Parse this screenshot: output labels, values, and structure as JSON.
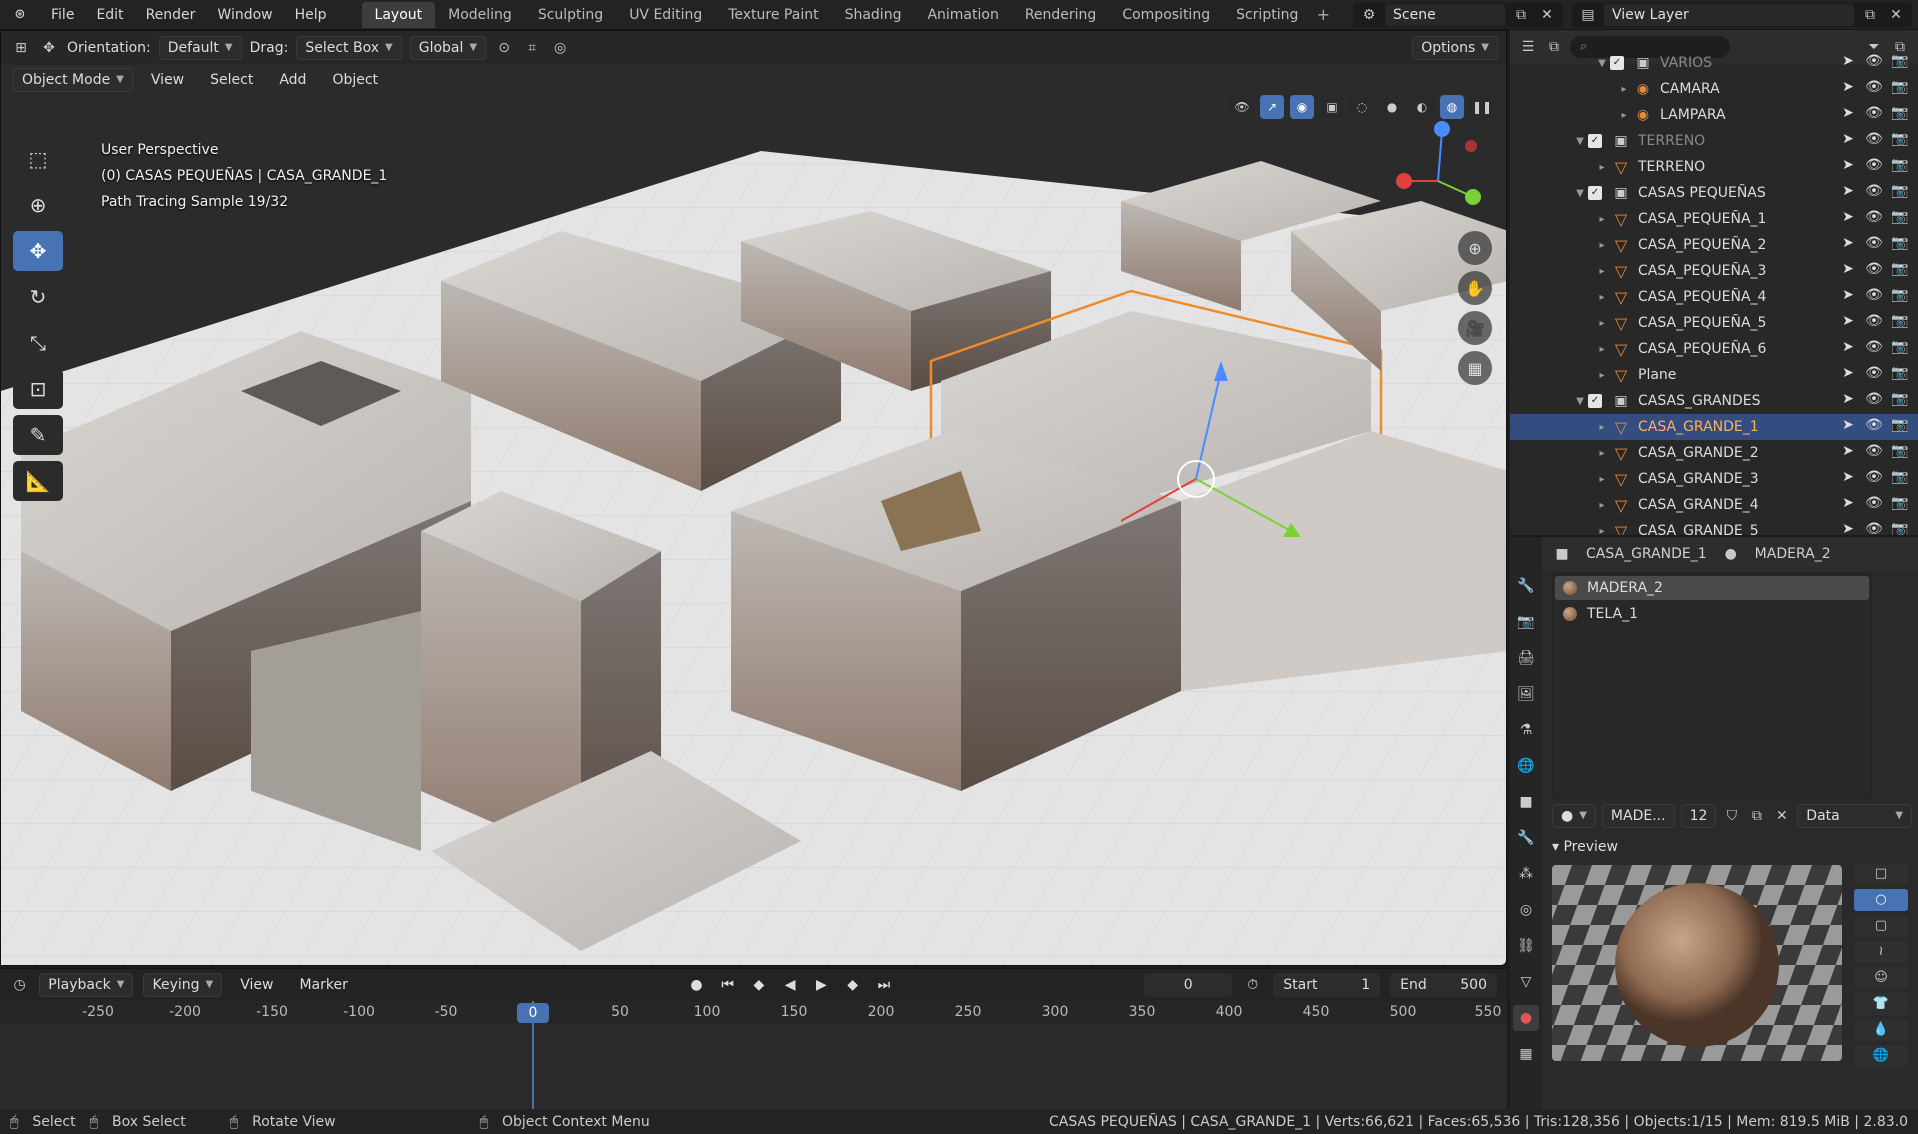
{
  "menus": [
    "File",
    "Edit",
    "Render",
    "Window",
    "Help"
  ],
  "workspaces": [
    "Layout",
    "Modeling",
    "Sculpting",
    "UV Editing",
    "Texture Paint",
    "Shading",
    "Animation",
    "Rendering",
    "Compositing",
    "Scripting"
  ],
  "scene": "Scene",
  "view_layer": "View Layer",
  "viewport": {
    "orientation_label": "Orientation:",
    "orientation": "Default",
    "drag_label": "Drag:",
    "drag": "Select Box",
    "transform": "Global",
    "options": "Options",
    "mode": "Object Mode",
    "menu": [
      "View",
      "Select",
      "Add",
      "Object"
    ],
    "overlay": [
      "User Perspective",
      "(0) CASAS PEQUEÑAS | CASA_GRANDE_1",
      "Path Tracing Sample 19/32"
    ]
  },
  "outliner": {
    "rows": [
      {
        "name": "VARIOS",
        "indent": 2,
        "type": "coll",
        "dim": true
      },
      {
        "name": "CAMARA",
        "indent": 3,
        "type": "cam"
      },
      {
        "name": "LAMPARA",
        "indent": 3,
        "type": "cam"
      },
      {
        "name": "TERRENO",
        "indent": 1,
        "type": "coll",
        "dim": true
      },
      {
        "name": "TERRENO",
        "indent": 2,
        "type": "obj"
      },
      {
        "name": "CASAS PEQUEÑAS",
        "indent": 1,
        "type": "coll"
      },
      {
        "name": "CASA_PEQUEÑA_1",
        "indent": 2,
        "type": "obj"
      },
      {
        "name": "CASA_PEQUEÑA_2",
        "indent": 2,
        "type": "obj"
      },
      {
        "name": "CASA_PEQUEÑA_3",
        "indent": 2,
        "type": "obj"
      },
      {
        "name": "CASA_PEQUEÑA_4",
        "indent": 2,
        "type": "obj"
      },
      {
        "name": "CASA_PEQUEÑA_5",
        "indent": 2,
        "type": "obj"
      },
      {
        "name": "CASA_PEQUEÑA_6",
        "indent": 2,
        "type": "obj"
      },
      {
        "name": "Plane",
        "indent": 2,
        "type": "obj"
      },
      {
        "name": "CASAS_GRANDES",
        "indent": 1,
        "type": "coll"
      },
      {
        "name": "CASA_GRANDE_1",
        "indent": 2,
        "type": "obj",
        "selected": true
      },
      {
        "name": "CASA_GRANDE_2",
        "indent": 2,
        "type": "obj"
      },
      {
        "name": "CASA_GRANDE_3",
        "indent": 2,
        "type": "obj"
      },
      {
        "name": "CASA_GRANDE_4",
        "indent": 2,
        "type": "obj"
      },
      {
        "name": "CASA_GRANDE_5",
        "indent": 2,
        "type": "obj"
      }
    ]
  },
  "properties": {
    "object": "CASA_GRANDE_1",
    "material": "MADERA_2",
    "slots": [
      "MADERA_2",
      "TELA_1"
    ],
    "mat_short": "MADE...",
    "users": "12",
    "link": "Data",
    "preview_label": "Preview"
  },
  "timeline": {
    "menu": [
      "Playback",
      "Keying",
      "View",
      "Marker"
    ],
    "current": "0",
    "start_label": "Start",
    "start": "1",
    "end_label": "End",
    "end": "500",
    "ticks": [
      "-250",
      "-200",
      "-150",
      "-100",
      "-50",
      "0",
      "50",
      "100",
      "150",
      "200",
      "250",
      "300",
      "350",
      "400",
      "450",
      "500",
      "550"
    ]
  },
  "status": {
    "select": "Select",
    "box_select": "Box Select",
    "rotate": "Rotate View",
    "context": "Object Context Menu",
    "stats": "CASAS PEQUEÑAS | CASA_GRANDE_1 | Verts:66,621 | Faces:65,536 | Tris:128,356 | Objects:1/15 | Mem: 819.5 MiB | 2.83.0"
  },
  "colors": {
    "accent": "#4772b3",
    "selection": "#334d80",
    "object_orange": "#e58a3a"
  }
}
